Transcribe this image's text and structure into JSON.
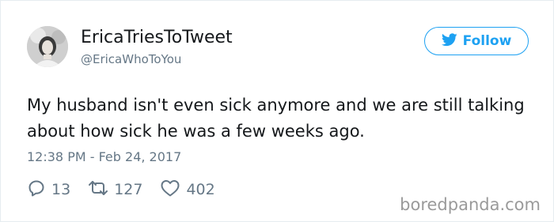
{
  "tweet": {
    "display_name": "EricaTriesToTweet",
    "handle": "@EricaWhoToYou",
    "text": "My husband isn't even sick anymore and we are still talking about how sick he was a few weeks ago.",
    "timestamp": "12:38 PM - Feb 24, 2017",
    "follow_label": "Follow",
    "stats": {
      "replies": "13",
      "retweets": "127",
      "likes": "402"
    }
  },
  "watermark": "boredpanda.com",
  "icons": {
    "follow": "twitter-bird-icon",
    "reply": "reply-icon",
    "retweet": "retweet-icon",
    "like": "heart-icon"
  },
  "colors": {
    "accent": "#1da1f2",
    "text": "#14171a",
    "muted": "#657786",
    "border": "#e6ecf0",
    "watermark": "#9a9a9a"
  }
}
